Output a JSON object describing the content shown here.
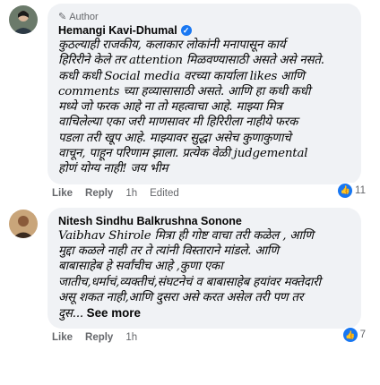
{
  "comments": [
    {
      "badge": "Author",
      "author": "Hemangi Kavi-Dhumal",
      "lines": [
        "कुठल्याही राजकीय, कलाकार लोकांनी मनापासून कार्य",
        "हिरिरीने केले तर attention मिळवण्यासाठी असते असे नसते.",
        "कधी कधी Social media वरच्या कार्याला likes आणि",
        "comments च्या हव्यासासाठी असते. आणि हा कधी कधी",
        "मध्ये जो फरक आहे ना तो महत्वाचा आहे. माझ्या मित्र",
        "वाचिलेल्या एका जरी माणसावर मी हिरिरीला नाहीये फरक",
        "पडला तरी खूप आहे. माझ्यावर सुद्धा असेच कुणाकुणाचे",
        "वाचून, पाहून परिणाम झाला. प्रत्येक वेळी judgemental",
        "होणं योग्य नाही! जय भीम"
      ],
      "actions": {
        "like": "Like",
        "reply": "Reply",
        "time": "1h",
        "edited": "Edited"
      },
      "reaction_count": "11"
    },
    {
      "author": "Nitesh Sindhu Balkrushna Sonone",
      "lines": [
        "Vaibhav Shirole मित्रा ही गोष्ट वाचा तरी कळेल , आणि",
        "मुद्दा कळले नाही तर ते त्यांनी विस्ताराने मांडले. आणि",
        "बाबासाहेब हे सर्वांचीच आहे ,कुणा एका",
        "जातीच,धर्माचं,व्यक्तीचं,संघटनेचं व बाबासाहेब हयांवर मक्तेदारी",
        "असू शकत नाही,आणि दुसरा असे करत असेल तरी पण तर",
        "दुस..."
      ],
      "see_more": "See more",
      "actions": {
        "like": "Like",
        "reply": "Reply",
        "time": "1h"
      },
      "reaction_count": "7"
    }
  ],
  "colors": {
    "bubble": "#f0f2f5",
    "accent": "#1877f2",
    "meta": "#65676b"
  }
}
